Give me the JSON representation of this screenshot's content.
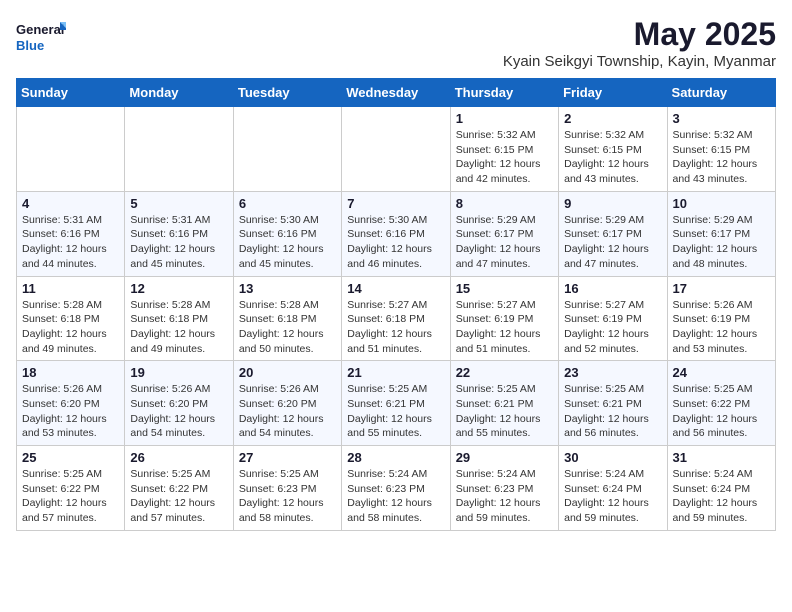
{
  "logo": {
    "line1": "General",
    "line2": "Blue"
  },
  "title": "May 2025",
  "location": "Kyain Seikgyi Township, Kayin, Myanmar",
  "days_of_week": [
    "Sunday",
    "Monday",
    "Tuesday",
    "Wednesday",
    "Thursday",
    "Friday",
    "Saturday"
  ],
  "weeks": [
    [
      {
        "day": "",
        "info": ""
      },
      {
        "day": "",
        "info": ""
      },
      {
        "day": "",
        "info": ""
      },
      {
        "day": "",
        "info": ""
      },
      {
        "day": "1",
        "info": "Sunrise: 5:32 AM\nSunset: 6:15 PM\nDaylight: 12 hours\nand 42 minutes."
      },
      {
        "day": "2",
        "info": "Sunrise: 5:32 AM\nSunset: 6:15 PM\nDaylight: 12 hours\nand 43 minutes."
      },
      {
        "day": "3",
        "info": "Sunrise: 5:32 AM\nSunset: 6:15 PM\nDaylight: 12 hours\nand 43 minutes."
      }
    ],
    [
      {
        "day": "4",
        "info": "Sunrise: 5:31 AM\nSunset: 6:16 PM\nDaylight: 12 hours\nand 44 minutes."
      },
      {
        "day": "5",
        "info": "Sunrise: 5:31 AM\nSunset: 6:16 PM\nDaylight: 12 hours\nand 45 minutes."
      },
      {
        "day": "6",
        "info": "Sunrise: 5:30 AM\nSunset: 6:16 PM\nDaylight: 12 hours\nand 45 minutes."
      },
      {
        "day": "7",
        "info": "Sunrise: 5:30 AM\nSunset: 6:16 PM\nDaylight: 12 hours\nand 46 minutes."
      },
      {
        "day": "8",
        "info": "Sunrise: 5:29 AM\nSunset: 6:17 PM\nDaylight: 12 hours\nand 47 minutes."
      },
      {
        "day": "9",
        "info": "Sunrise: 5:29 AM\nSunset: 6:17 PM\nDaylight: 12 hours\nand 47 minutes."
      },
      {
        "day": "10",
        "info": "Sunrise: 5:29 AM\nSunset: 6:17 PM\nDaylight: 12 hours\nand 48 minutes."
      }
    ],
    [
      {
        "day": "11",
        "info": "Sunrise: 5:28 AM\nSunset: 6:18 PM\nDaylight: 12 hours\nand 49 minutes."
      },
      {
        "day": "12",
        "info": "Sunrise: 5:28 AM\nSunset: 6:18 PM\nDaylight: 12 hours\nand 49 minutes."
      },
      {
        "day": "13",
        "info": "Sunrise: 5:28 AM\nSunset: 6:18 PM\nDaylight: 12 hours\nand 50 minutes."
      },
      {
        "day": "14",
        "info": "Sunrise: 5:27 AM\nSunset: 6:18 PM\nDaylight: 12 hours\nand 51 minutes."
      },
      {
        "day": "15",
        "info": "Sunrise: 5:27 AM\nSunset: 6:19 PM\nDaylight: 12 hours\nand 51 minutes."
      },
      {
        "day": "16",
        "info": "Sunrise: 5:27 AM\nSunset: 6:19 PM\nDaylight: 12 hours\nand 52 minutes."
      },
      {
        "day": "17",
        "info": "Sunrise: 5:26 AM\nSunset: 6:19 PM\nDaylight: 12 hours\nand 53 minutes."
      }
    ],
    [
      {
        "day": "18",
        "info": "Sunrise: 5:26 AM\nSunset: 6:20 PM\nDaylight: 12 hours\nand 53 minutes."
      },
      {
        "day": "19",
        "info": "Sunrise: 5:26 AM\nSunset: 6:20 PM\nDaylight: 12 hours\nand 54 minutes."
      },
      {
        "day": "20",
        "info": "Sunrise: 5:26 AM\nSunset: 6:20 PM\nDaylight: 12 hours\nand 54 minutes."
      },
      {
        "day": "21",
        "info": "Sunrise: 5:25 AM\nSunset: 6:21 PM\nDaylight: 12 hours\nand 55 minutes."
      },
      {
        "day": "22",
        "info": "Sunrise: 5:25 AM\nSunset: 6:21 PM\nDaylight: 12 hours\nand 55 minutes."
      },
      {
        "day": "23",
        "info": "Sunrise: 5:25 AM\nSunset: 6:21 PM\nDaylight: 12 hours\nand 56 minutes."
      },
      {
        "day": "24",
        "info": "Sunrise: 5:25 AM\nSunset: 6:22 PM\nDaylight: 12 hours\nand 56 minutes."
      }
    ],
    [
      {
        "day": "25",
        "info": "Sunrise: 5:25 AM\nSunset: 6:22 PM\nDaylight: 12 hours\nand 57 minutes."
      },
      {
        "day": "26",
        "info": "Sunrise: 5:25 AM\nSunset: 6:22 PM\nDaylight: 12 hours\nand 57 minutes."
      },
      {
        "day": "27",
        "info": "Sunrise: 5:25 AM\nSunset: 6:23 PM\nDaylight: 12 hours\nand 58 minutes."
      },
      {
        "day": "28",
        "info": "Sunrise: 5:24 AM\nSunset: 6:23 PM\nDaylight: 12 hours\nand 58 minutes."
      },
      {
        "day": "29",
        "info": "Sunrise: 5:24 AM\nSunset: 6:23 PM\nDaylight: 12 hours\nand 59 minutes."
      },
      {
        "day": "30",
        "info": "Sunrise: 5:24 AM\nSunset: 6:24 PM\nDaylight: 12 hours\nand 59 minutes."
      },
      {
        "day": "31",
        "info": "Sunrise: 5:24 AM\nSunset: 6:24 PM\nDaylight: 12 hours\nand 59 minutes."
      }
    ]
  ]
}
